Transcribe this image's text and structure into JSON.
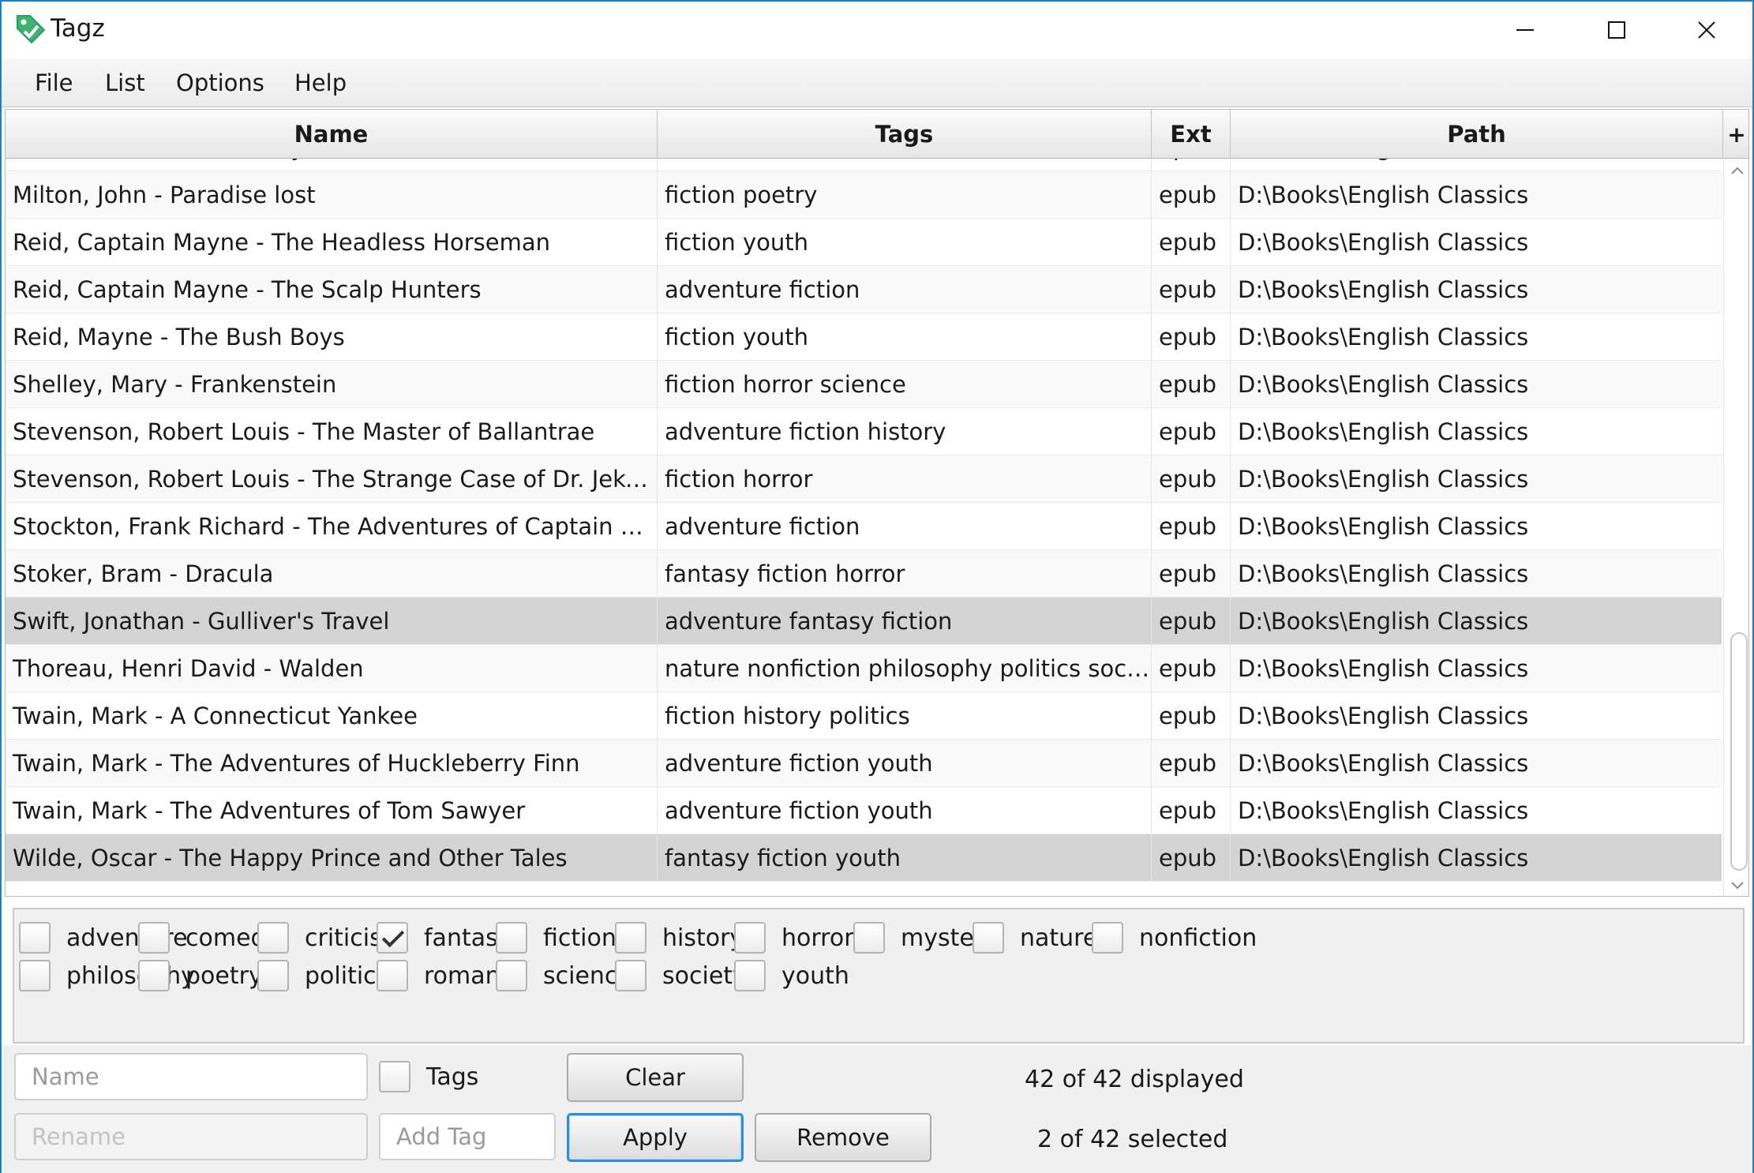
{
  "window": {
    "title": "Tagz"
  },
  "menu": {
    "file": "File",
    "list": "List",
    "options": "Options",
    "help": "Help"
  },
  "table": {
    "columns": {
      "name": "Name",
      "tags": "Tags",
      "ext": "Ext",
      "path": "Path",
      "add": "+"
    },
    "rows": [
      {
        "name": "Melville, Hermann - Moby Dick",
        "tags": "adventure fiction",
        "ext": "epub",
        "path": "D:\\Books\\English Classics",
        "selected": false
      },
      {
        "name": "Milton, John - Paradise lost",
        "tags": "fiction poetry",
        "ext": "epub",
        "path": "D:\\Books\\English Classics",
        "selected": false
      },
      {
        "name": "Reid, Captain Mayne - The Headless Horseman",
        "tags": "fiction youth",
        "ext": "epub",
        "path": "D:\\Books\\English Classics",
        "selected": false
      },
      {
        "name": "Reid, Captain Mayne - The Scalp Hunters",
        "tags": "adventure fiction",
        "ext": "epub",
        "path": "D:\\Books\\English Classics",
        "selected": false
      },
      {
        "name": "Reid, Mayne - The Bush Boys",
        "tags": "fiction youth",
        "ext": "epub",
        "path": "D:\\Books\\English Classics",
        "selected": false
      },
      {
        "name": "Shelley, Mary - Frankenstein",
        "tags": "fiction horror science",
        "ext": "epub",
        "path": "D:\\Books\\English Classics",
        "selected": false
      },
      {
        "name": "Stevenson, Robert Louis  - The Master of Ballantrae",
        "tags": "adventure fiction history",
        "ext": "epub",
        "path": "D:\\Books\\English Classics",
        "selected": false
      },
      {
        "name": "Stevenson, Robert Louis - The Strange Case of Dr. Jekyll an...",
        "tags": "fiction horror",
        "ext": "epub",
        "path": "D:\\Books\\English Classics",
        "selected": false
      },
      {
        "name": "Stockton, Frank Richard - The Adventures of Captain Horn",
        "tags": "adventure fiction",
        "ext": "epub",
        "path": "D:\\Books\\English Classics",
        "selected": false
      },
      {
        "name": "Stoker, Bram - Dracula",
        "tags": "fantasy fiction horror",
        "ext": "epub",
        "path": "D:\\Books\\English Classics",
        "selected": false
      },
      {
        "name": "Swift, Jonathan - Gulliver's Travel",
        "tags": "adventure fantasy fiction",
        "ext": "epub",
        "path": "D:\\Books\\English Classics",
        "selected": true
      },
      {
        "name": "Thoreau, Henri David - Walden",
        "tags": "nature nonfiction philosophy politics society",
        "ext": "epub",
        "path": "D:\\Books\\English Classics",
        "selected": false
      },
      {
        "name": "Twain,  Mark - A Connecticut Yankee",
        "tags": "fiction history politics",
        "ext": "epub",
        "path": "D:\\Books\\English Classics",
        "selected": false
      },
      {
        "name": "Twain, Mark  - The Adventures of Huckleberry Finn",
        "tags": "adventure fiction youth",
        "ext": "epub",
        "path": "D:\\Books\\English Classics",
        "selected": false
      },
      {
        "name": "Twain, Mark - The Adventures of Tom Sawyer",
        "tags": "adventure fiction youth",
        "ext": "epub",
        "path": "D:\\Books\\English Classics",
        "selected": false
      },
      {
        "name": "Wilde, Oscar - The Happy Prince and Other Tales",
        "tags": "fantasy fiction youth",
        "ext": "epub",
        "path": "D:\\Books\\English Classics",
        "selected": true
      }
    ]
  },
  "tags": [
    {
      "label": "adventure",
      "checked": false
    },
    {
      "label": "comedy",
      "checked": false
    },
    {
      "label": "criticism",
      "checked": false
    },
    {
      "label": "fantasy",
      "checked": true
    },
    {
      "label": "fiction",
      "checked": false
    },
    {
      "label": "history",
      "checked": false
    },
    {
      "label": "horror",
      "checked": false
    },
    {
      "label": "mystery",
      "checked": false
    },
    {
      "label": "nature",
      "checked": false
    },
    {
      "label": "nonfiction",
      "checked": false
    },
    {
      "label": "philosophy",
      "checked": false
    },
    {
      "label": "poetry",
      "checked": false
    },
    {
      "label": "politics",
      "checked": false
    },
    {
      "label": "romance",
      "checked": false
    },
    {
      "label": "science",
      "checked": false
    },
    {
      "label": "society",
      "checked": false
    },
    {
      "label": "youth",
      "checked": false
    }
  ],
  "controls": {
    "name_placeholder": "Name",
    "name_value": "",
    "tags_checkbox_label": "Tags",
    "tags_checked": false,
    "clear_label": "Clear",
    "rename_placeholder": "Rename",
    "add_tag_placeholder": "Add Tag",
    "apply_label": "Apply",
    "remove_label": "Remove",
    "displayed_status": "42 of 42 displayed",
    "selected_status": "2 of 42 selected"
  },
  "colors": {
    "window_border": "#1e7fc4",
    "icon_green": "#3cb371",
    "selection": "#d4d4d4",
    "focus_blue": "#2d8fd8"
  },
  "icons": {
    "app": "tag-icon",
    "minimize": "minimize-icon",
    "maximize": "maximize-icon",
    "close": "close-icon"
  }
}
